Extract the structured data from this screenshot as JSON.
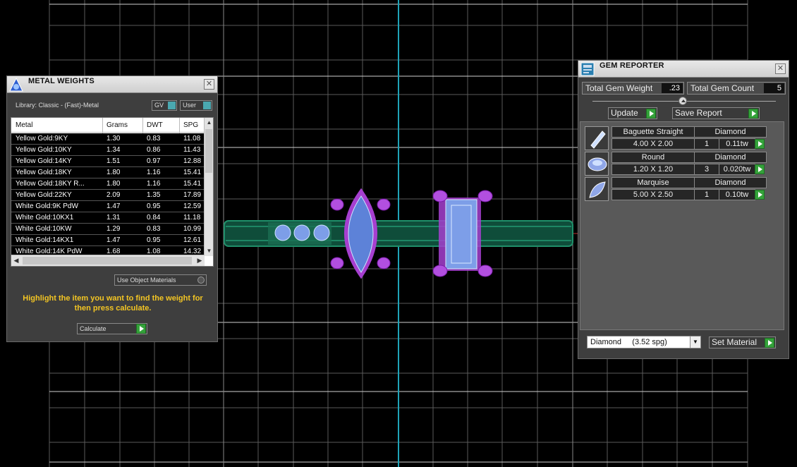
{
  "metal_weights": {
    "title": "METAL WEIGHTS",
    "library_label": "Library: Classic - (Fast)-Metal",
    "toggle_gv": "GV",
    "toggle_user": "User",
    "columns": [
      "Metal",
      "Grams",
      "DWT",
      "SPG"
    ],
    "rows": [
      [
        "Yellow Gold:9KY",
        "1.30",
        "0.83",
        "11.08"
      ],
      [
        "Yellow Gold:10KY",
        "1.34",
        "0.86",
        "11.43"
      ],
      [
        "Yellow Gold:14KY",
        "1.51",
        "0.97",
        "12.88"
      ],
      [
        "Yellow Gold:18KY",
        "1.80",
        "1.16",
        "15.41"
      ],
      [
        "Yellow Gold:18KY R...",
        "1.80",
        "1.16",
        "15.41"
      ],
      [
        "Yellow Gold:22KY",
        "2.09",
        "1.35",
        "17.89"
      ],
      [
        "White Gold:9K PdW",
        "1.47",
        "0.95",
        "12.59"
      ],
      [
        "White Gold:10KX1",
        "1.31",
        "0.84",
        "11.18"
      ],
      [
        "White Gold:10KW",
        "1.29",
        "0.83",
        "10.99"
      ],
      [
        "White Gold:14KX1",
        "1.47",
        "0.95",
        "12.61"
      ],
      [
        "White Gold:14K PdW",
        "1.68",
        "1.08",
        "14.32"
      ]
    ],
    "use_object_materials": "Use Object Materials",
    "hint": "Highlight the item you want to find the weight for then press calculate.",
    "calculate_label": "Calculate"
  },
  "gem_reporter": {
    "title": "GEM REPORTER",
    "total_weight_label": "Total Gem Weight",
    "total_weight_value": ".23",
    "total_count_label": "Total Gem Count",
    "total_count_value": "5",
    "update_label": "Update",
    "save_report_label": "Save Report",
    "gems": [
      {
        "shape": "Baguette Straight",
        "material": "Diamond",
        "size": "4.00 X 2.00",
        "count": "1",
        "weight": "0.11tw",
        "icon": "baguette-gem-icon"
      },
      {
        "shape": "Round",
        "material": "Diamond",
        "size": "1.20 X 1.20",
        "count": "3",
        "weight": "0.020tw",
        "icon": "round-gem-icon"
      },
      {
        "shape": "Marquise",
        "material": "Diamond",
        "size": "5.00 X 2.50",
        "count": "1",
        "weight": "0.10tw",
        "icon": "marquise-gem-icon"
      }
    ],
    "material_select": "Diamond     (3.52 spg)",
    "set_material_label": "Set Material"
  },
  "colors": {
    "grid": "#5a5a5a",
    "axis": "#1fa3b8",
    "band": "#1f8f6a",
    "prong": "#a63fd0",
    "gem": "#7d9ee8",
    "hint": "#f3c523",
    "button_green": "#34a23a"
  }
}
